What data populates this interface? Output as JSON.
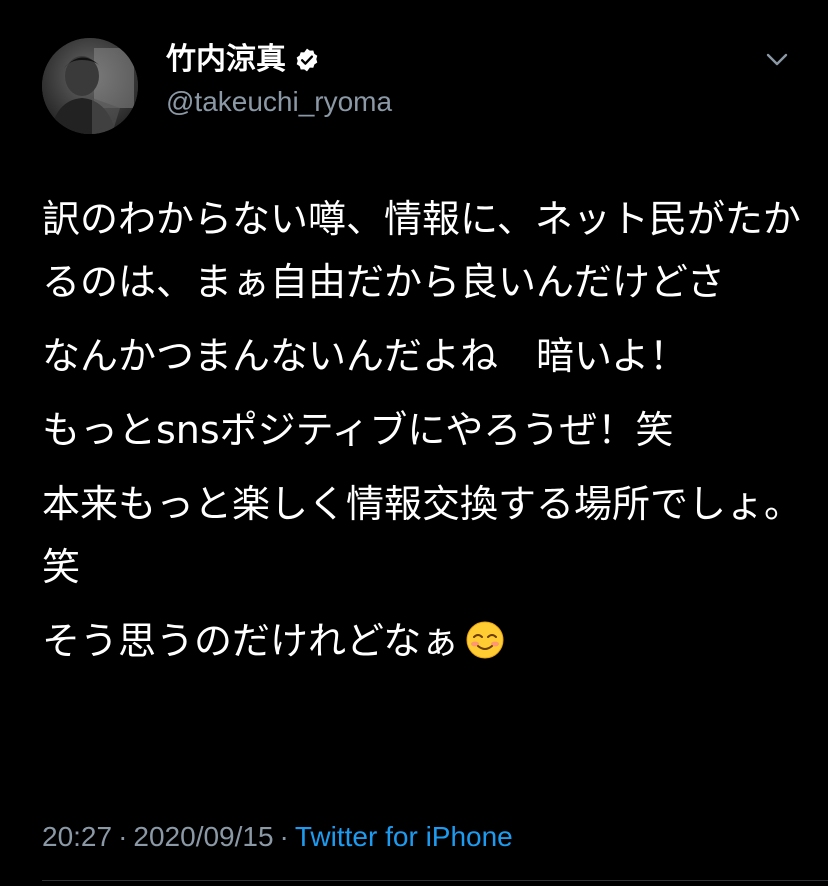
{
  "user": {
    "display_name": "竹内涼真",
    "handle": "@takeuchi_ryoma",
    "verified": true
  },
  "tweet": {
    "paragraphs": [
      "訳のわからない噂、情報に、ネット民がたかるのは、まぁ自由だから良いんだけどさ",
      "なんかつまんないんだよね　暗いよ！",
      "もっとsnsポジティブにやろうぜ！笑",
      "本来もっと楽しく情報交換する場所でしょ。笑",
      "そう思うのだけれどなぁ"
    ],
    "trailing_emoji": "smiling-face-icon"
  },
  "meta": {
    "time": "20:27",
    "separator": "·",
    "date": "2020/09/15",
    "source": "Twitter for iPhone"
  },
  "colors": {
    "background": "#000000",
    "text": "#ffffff",
    "secondary": "#8b98a5",
    "link": "#1d9bf0"
  }
}
